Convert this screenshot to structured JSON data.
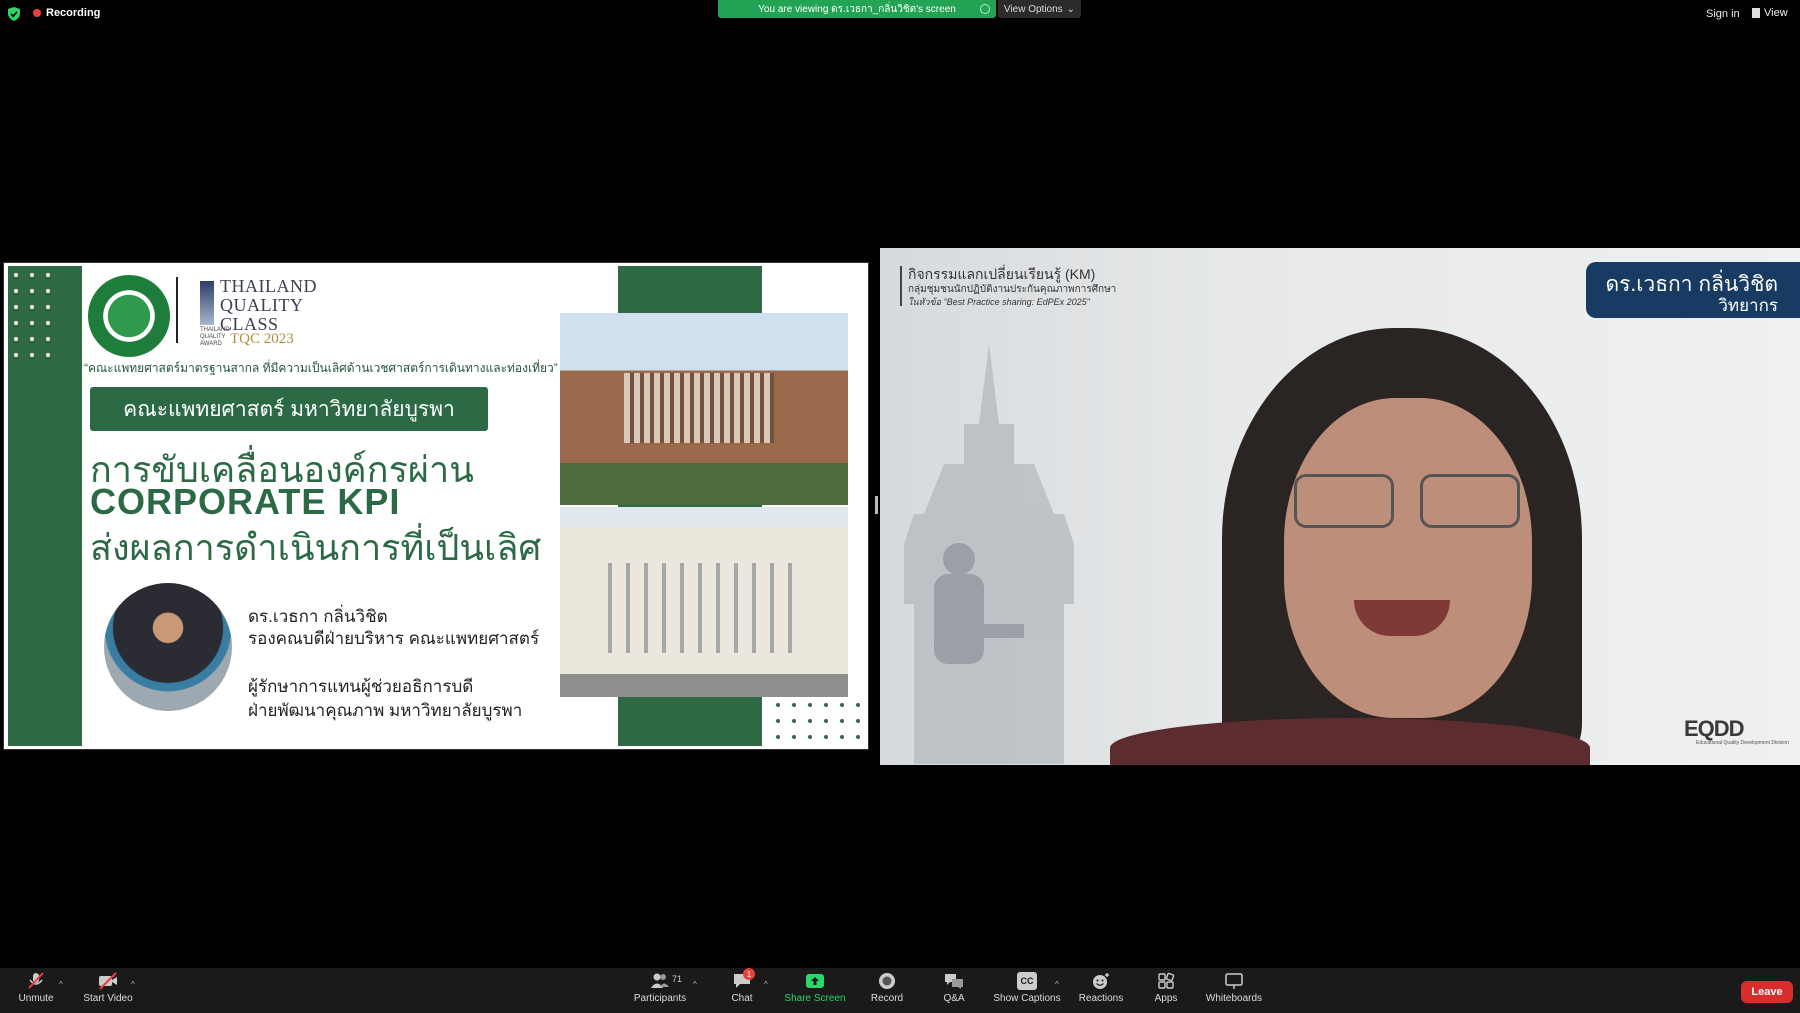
{
  "topbar": {
    "recording_label": "Recording",
    "viewing_banner": "You are viewing ดร.เวธกา_กลิ่นวิชิต's screen",
    "view_options_label": "View Options",
    "sign_in_label": "Sign in",
    "view_label": "View"
  },
  "slide": {
    "tqc_title_lines": [
      "THAILAND",
      "QUALITY",
      "CLASS"
    ],
    "tqc_sub": "THAILAND QUALITY AWARD",
    "tqc_year": "TQC 2023",
    "slogan": "“คณะแพทยศาสตร์มาตรฐานสากล ที่มีความเป็นเลิศด้านเวชศาสตร์การเดินทางและท่องเที่ยว”",
    "faculty": "คณะแพทยศาสตร์ มหาวิทยาลัยบูรพา",
    "headline_1": "การขับเคลื่อนองค์กรผ่าน",
    "headline_2": "CORPORATE KPI",
    "headline_3": "ส่งผลการดำเนินการที่เป็นเลิศ",
    "presenter_name": "ดร.เวธกา กลิ่นวิชิต",
    "presenter_role1": "รองคณบดีฝ่ายบริหาร คณะแพทยศาสตร์",
    "presenter_role2": "ผู้รักษาการแทนผู้ช่วยอธิการบดี",
    "presenter_role3": "ฝ่ายพัฒนาคุณภาพ มหาวิทยาลัยบูรพา"
  },
  "speaker": {
    "km_title": "กิจกรรมแลกเปลี่ยนเรียนรู้ (KM)",
    "km_sub": "กลุ่มชุมชนนักปฏิบัติงานประกันคุณภาพการศึกษา",
    "km_topic": "ในหัวข้อ  “Best Practice sharing: EdPEx 2025”",
    "nameplate_name": "ดร.เวธกา กลิ่นวิชิต",
    "nameplate_role": "วิทยากร",
    "logo_text": "EQDD",
    "logo_sub": "Educational Quality Development Division"
  },
  "toolbar": {
    "unmute": "Unmute",
    "start_video": "Start Video",
    "participants": "Participants",
    "participants_count": "71",
    "chat": "Chat",
    "chat_badge": "1",
    "share_screen": "Share Screen",
    "record": "Record",
    "qa": "Q&A",
    "show_captions": "Show Captions",
    "cc": "CC",
    "reactions": "Reactions",
    "apps": "Apps",
    "whiteboards": "Whiteboards",
    "leave": "Leave"
  },
  "colors": {
    "brand_green": "#2f6a45",
    "banner_green": "#23a455",
    "leave_red": "#d92d2d",
    "nameplate_blue": "#173b62"
  },
  "icons": [
    "shield-check-icon",
    "record-dot-icon",
    "microphone-muted-icon",
    "video-off-icon",
    "participants-icon",
    "chat-icon",
    "share-screen-icon",
    "record-icon",
    "qa-icon",
    "captions-icon",
    "reactions-icon",
    "apps-icon",
    "whiteboard-icon"
  ]
}
